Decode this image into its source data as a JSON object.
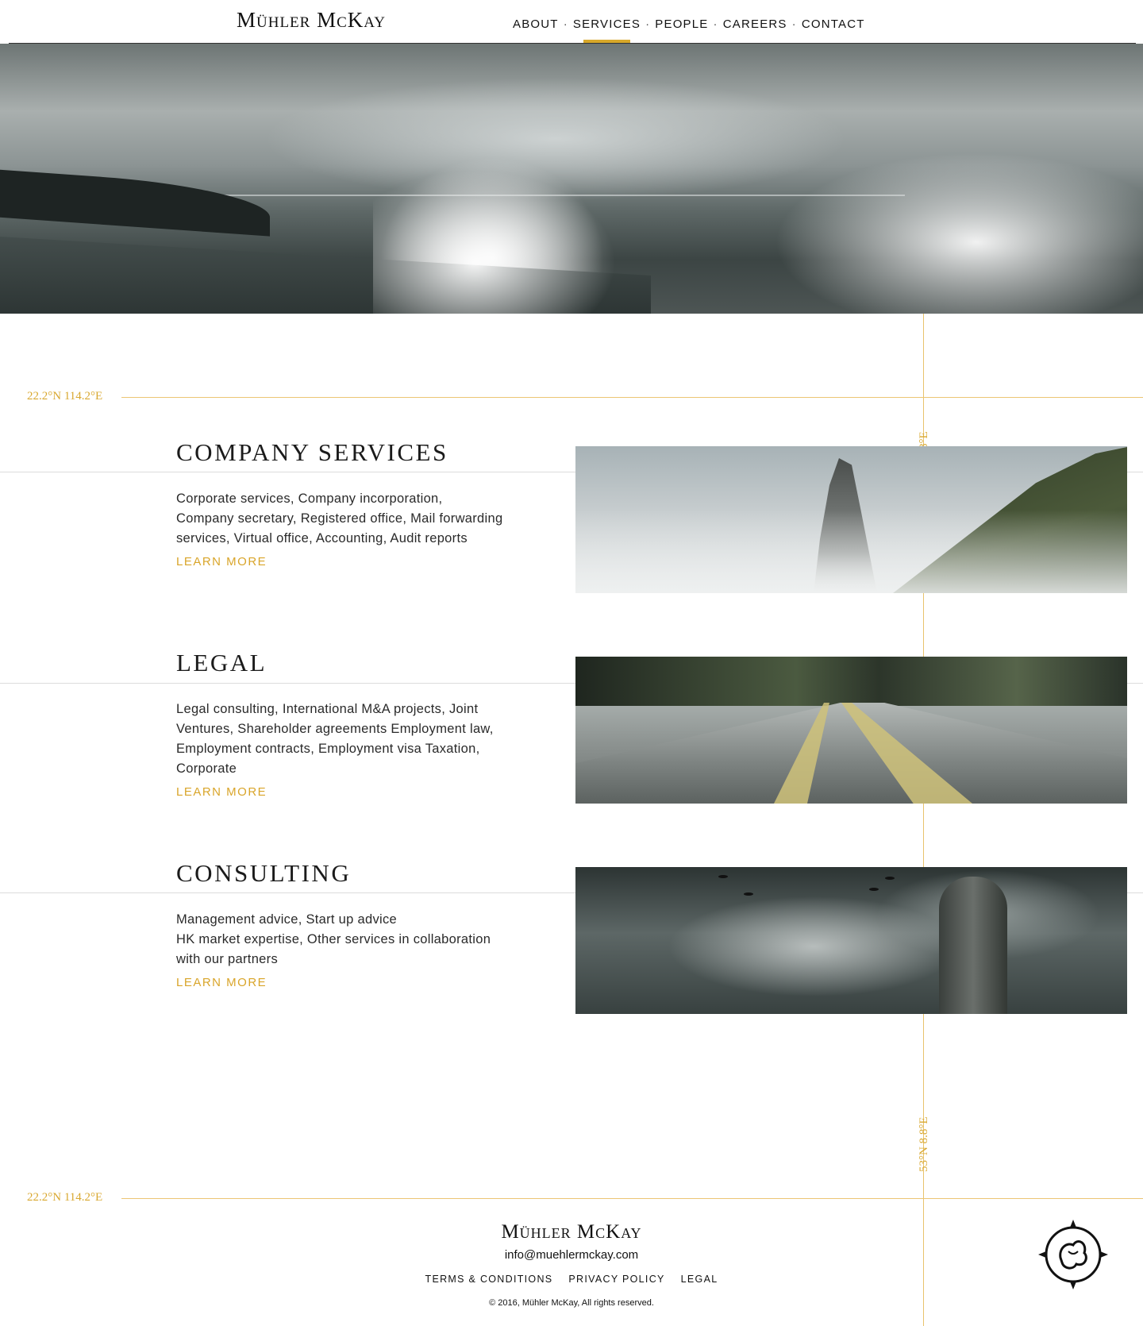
{
  "header": {
    "logo": "Mühler McKay",
    "nav": [
      {
        "label": "ABOUT",
        "active": false
      },
      {
        "label": "SERVICES",
        "active": true
      },
      {
        "label": "PEOPLE",
        "active": false
      },
      {
        "label": "CAREERS",
        "active": false
      },
      {
        "label": "CONTACT",
        "active": false
      }
    ],
    "separator": "·"
  },
  "hero": {
    "image": "stormy-sea-beach"
  },
  "coordinates": {
    "top_left": "22.2°N 114.2°E",
    "bottom_left": "22.2°N 114.2°E",
    "vertical_top": "8°E",
    "vertical_bottom": "53°N 8.8°E"
  },
  "services": [
    {
      "title": "COMPANY SERVICES",
      "description_lines": [
        "Corporate services, Company incorporation,",
        "Company secretary, Registered office, Mail forwarding",
        "services, Virtual office, Accounting, Audit reports"
      ],
      "link": "LEARN MORE",
      "image": "misty-mountain-forest"
    },
    {
      "title": "LEGAL",
      "description_lines": [
        "Legal consulting, International M&A projects, Joint",
        "Ventures, Shareholder agreements Employment law,",
        "Employment contracts, Employment visa Taxation,",
        "Corporate"
      ],
      "link": "LEARN MORE",
      "image": "forest-road"
    },
    {
      "title": "CONSULTING",
      "description_lines": [
        "Management advice, Start up advice",
        "HK market expertise, Other services in collaboration",
        "with our partners"
      ],
      "link": "LEARN MORE",
      "image": "cloudy-sky-totem"
    }
  ],
  "footer": {
    "logo": "Mühler McKay",
    "email": "info@muehlermckay.com",
    "links": [
      "TERMS & CONDITIONS",
      "PRIVACY POLICY",
      "LEGAL"
    ],
    "copyright": "© 2016, Mühler McKay, All rights reserved.",
    "emblem": "compass-emblem-icon"
  },
  "colors": {
    "accent": "#d9a52a",
    "text": "#222222",
    "rule": "#dcdcdc"
  }
}
